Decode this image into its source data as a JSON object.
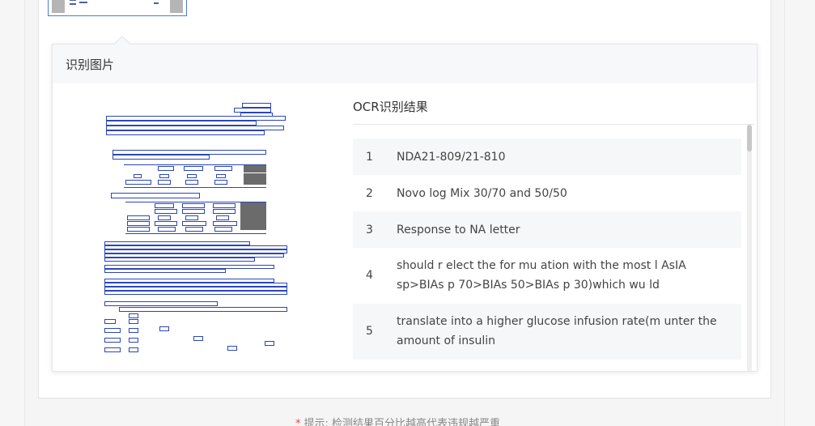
{
  "popover": {
    "title": "识别图片"
  },
  "ocr": {
    "title": "OCR识别结果",
    "rows": [
      {
        "num": "1",
        "text": "NDA21-809/21-810"
      },
      {
        "num": "2",
        "text": "Novo log Mix 30/70 and 50/50"
      },
      {
        "num": "3",
        "text": "Response to NA letter"
      },
      {
        "num": "4",
        "text": "should r elect the for mu ation with the most l AsIA sp>BIAs p 70>BIAs 50>BIAs p 30)which wu ld"
      },
      {
        "num": "5",
        "text": "translate into a higher glucose infusion rate(m unter the amount of insulin"
      }
    ]
  },
  "hint": {
    "star": "*",
    "text": "提示: 检测结果百分比越高代表违规越严重"
  },
  "colors": {
    "accent": "#2c46b8",
    "header_bg": "#f7f8fa"
  }
}
